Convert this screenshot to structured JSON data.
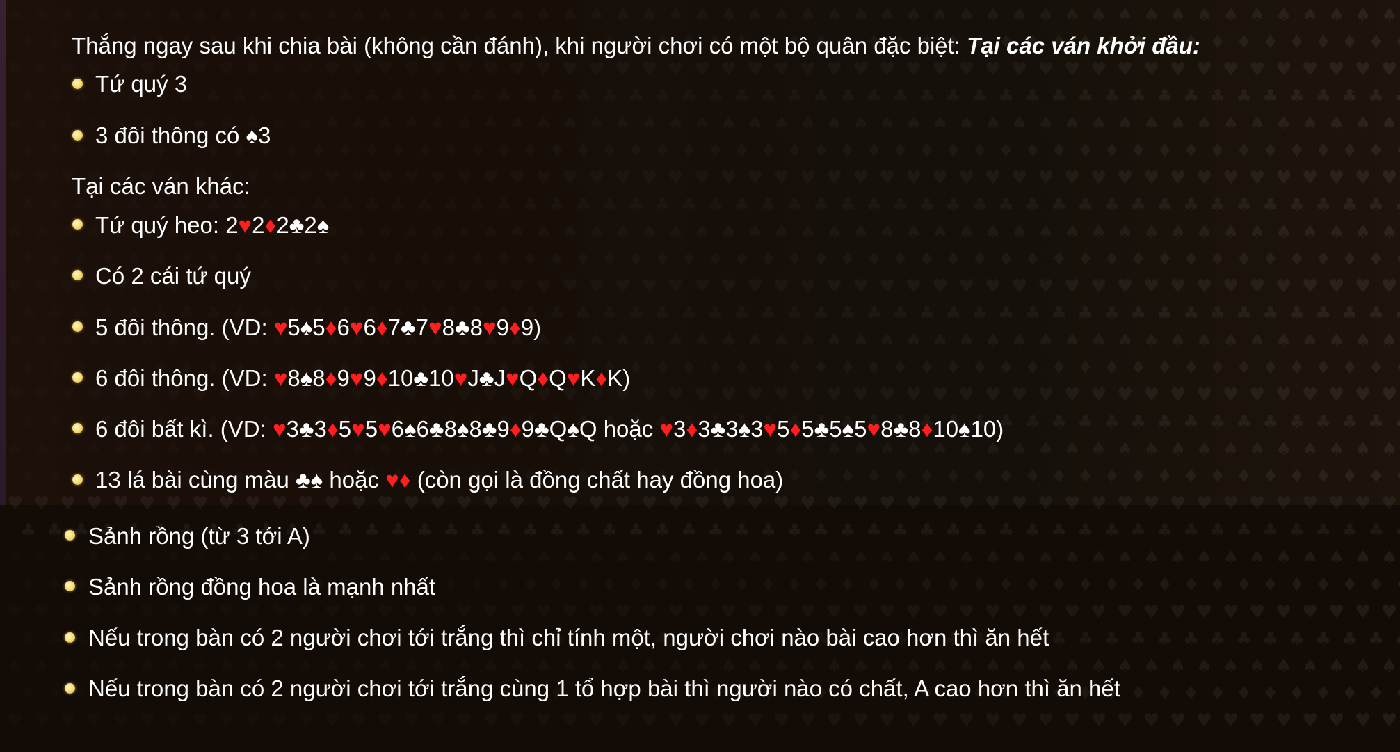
{
  "intro": {
    "lead": "Thắng ngay sau khi chia bài (không cần đánh), khi người chơi có một bộ quân đặc biệt: ",
    "emphasis": "Tại các ván khởi đầu:"
  },
  "first_game_items": [
    [
      {
        "t": "Tứ quý 3"
      }
    ],
    [
      {
        "t": "3 đôi thông có ♠3"
      }
    ]
  ],
  "other_games_heading": "Tại các ván khác:",
  "other_game_items": [
    [
      {
        "t": "Tứ quý heo: 2"
      },
      {
        "t": "♥",
        "c": "red"
      },
      {
        "t": "2"
      },
      {
        "t": "♦",
        "c": "red"
      },
      {
        "t": "2♣2♠"
      }
    ],
    [
      {
        "t": "Có 2 cái tứ quý"
      }
    ],
    [
      {
        "t": "5 đôi thông. (VD: "
      },
      {
        "t": "♥",
        "c": "red"
      },
      {
        "t": "5♠5"
      },
      {
        "t": "♦",
        "c": "red"
      },
      {
        "t": "6"
      },
      {
        "t": "♥",
        "c": "red"
      },
      {
        "t": "6"
      },
      {
        "t": "♦",
        "c": "red"
      },
      {
        "t": "7♣7"
      },
      {
        "t": "♥",
        "c": "red"
      },
      {
        "t": "8♣8"
      },
      {
        "t": "♥",
        "c": "red"
      },
      {
        "t": "9"
      },
      {
        "t": "♦",
        "c": "red"
      },
      {
        "t": "9)"
      }
    ],
    [
      {
        "t": "6 đôi thông. (VD: "
      },
      {
        "t": "♥",
        "c": "red"
      },
      {
        "t": "8♠8"
      },
      {
        "t": "♦",
        "c": "red"
      },
      {
        "t": "9"
      },
      {
        "t": "♥",
        "c": "red"
      },
      {
        "t": "9"
      },
      {
        "t": "♦",
        "c": "red"
      },
      {
        "t": "10♣10"
      },
      {
        "t": "♥",
        "c": "red"
      },
      {
        "t": "J♣J"
      },
      {
        "t": "♥",
        "c": "red"
      },
      {
        "t": "Q"
      },
      {
        "t": "♦",
        "c": "red"
      },
      {
        "t": "Q"
      },
      {
        "t": "♥",
        "c": "red"
      },
      {
        "t": "K"
      },
      {
        "t": "♦",
        "c": "red"
      },
      {
        "t": "K)"
      }
    ],
    [
      {
        "t": "6 đôi bất kì. (VD: "
      },
      {
        "t": "♥",
        "c": "red"
      },
      {
        "t": "3♣3"
      },
      {
        "t": "♦",
        "c": "red"
      },
      {
        "t": "5"
      },
      {
        "t": "♥",
        "c": "red"
      },
      {
        "t": "5"
      },
      {
        "t": "♥",
        "c": "red"
      },
      {
        "t": "6♠6♣8♠8♣9"
      },
      {
        "t": "♦",
        "c": "red"
      },
      {
        "t": "9♣Q♠Q hoặc "
      },
      {
        "t": "♥",
        "c": "red"
      },
      {
        "t": "3"
      },
      {
        "t": "♦",
        "c": "red"
      },
      {
        "t": "3♣3♠3"
      },
      {
        "t": "♥",
        "c": "red"
      },
      {
        "t": "5"
      },
      {
        "t": "♦",
        "c": "red"
      },
      {
        "t": "5♣5♠5"
      },
      {
        "t": "♥",
        "c": "red"
      },
      {
        "t": "8♣8"
      },
      {
        "t": "♦",
        "c": "red"
      },
      {
        "t": "10♠10)"
      }
    ],
    [
      {
        "t": "13 lá bài cùng màu ♣♠ hoặc "
      },
      {
        "t": "♥♦",
        "c": "red"
      },
      {
        "t": " (còn gọi là đồng chất hay đồng hoa)"
      }
    ]
  ],
  "lower_items": [
    "Sảnh rồng (từ 3 tới A)",
    "Sảnh rồng đồng hoa là mạnh nhất",
    "Nếu trong bàn có 2 người chơi tới trắng thì chỉ tính một, người chơi nào bài cao hơn thì ăn hết",
    "Nếu trong bàn có 2 người chơi tới trắng cùng 1 tổ hợp bài thì người nào có chất, A cao hơn thì ăn hết"
  ]
}
